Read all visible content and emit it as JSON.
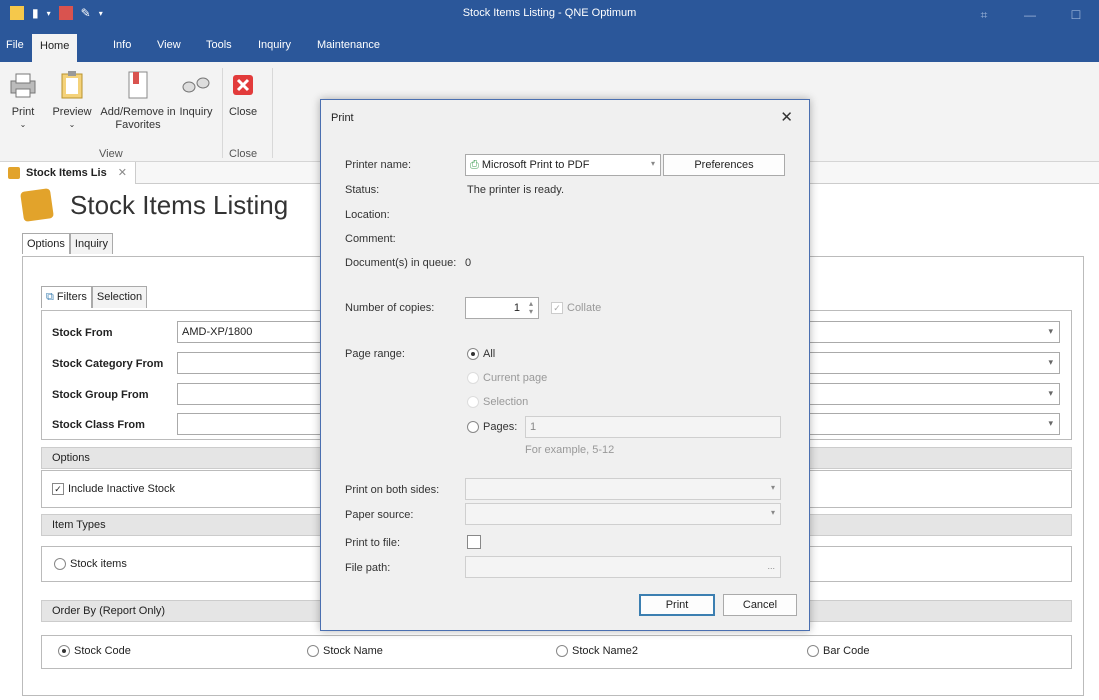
{
  "window": {
    "title": "Stock Items Listing - QNE Optimum",
    "qat_icons": [
      "app-icon",
      "clipboard-icon",
      "book-icon",
      "wrench-icon",
      "dropdown-icon"
    ],
    "controls": [
      "restore-icon",
      "minimize-icon",
      "maximize-icon"
    ]
  },
  "menu": {
    "items": [
      "File",
      "Home",
      "Info",
      "View",
      "Tools",
      "Inquiry",
      "Maintenance"
    ],
    "active": "Home"
  },
  "ribbon": {
    "buttons": {
      "print": "Print",
      "preview": "Preview",
      "favorites": "Add/Remove in Favorites",
      "inquiry": "Inquiry",
      "close": "Close"
    },
    "groups": {
      "view": "View",
      "close": "Close"
    }
  },
  "doc_tab": {
    "label": "Stock Items Lis"
  },
  "page": {
    "heading": "Stock Items Listing",
    "tabs": [
      "Options",
      "Inquiry"
    ],
    "subtabs": [
      "Filters",
      "Selection"
    ],
    "filters": {
      "stock_from": {
        "label": "Stock From",
        "value": "AMD-XP/1800"
      },
      "category_from": {
        "label": "Stock Category From",
        "value": ""
      },
      "group_from": {
        "label": "Stock Group From",
        "value": ""
      },
      "class_from": {
        "label": "Stock Class From",
        "value": ""
      }
    },
    "options_section": {
      "title": "Options",
      "inactive_label": "Include Inactive Stock",
      "inactive_checked": true
    },
    "item_types": {
      "title": "Item Types",
      "stock_items": "Stock items"
    },
    "order_by": {
      "title": "Order By (Report Only)",
      "options": [
        "Stock Code",
        "Stock Name",
        "Stock Name2",
        "Bar Code"
      ],
      "selected": "Stock Code"
    }
  },
  "print_dialog": {
    "title": "Print",
    "printer_name_label": "Printer name:",
    "printer_name": "Microsoft Print to PDF",
    "preferences": "Preferences",
    "status_label": "Status:",
    "status": "The printer is ready.",
    "location_label": "Location:",
    "comment_label": "Comment:",
    "queue_label": "Document(s) in queue:",
    "queue": "0",
    "copies_label": "Number of copies:",
    "copies": "1",
    "collate": "Collate",
    "page_range_label": "Page range:",
    "range_all": "All",
    "range_current": "Current page",
    "range_selection": "Selection",
    "range_pages": "Pages:",
    "pages_value": "1",
    "example": "For example, 5-12",
    "duplex_label": "Print on both sides:",
    "paper_source_label": "Paper source:",
    "print_to_file_label": "Print to file:",
    "file_path_label": "File path:",
    "file_path_button": "...",
    "print_button": "Print",
    "cancel_button": "Cancel"
  }
}
